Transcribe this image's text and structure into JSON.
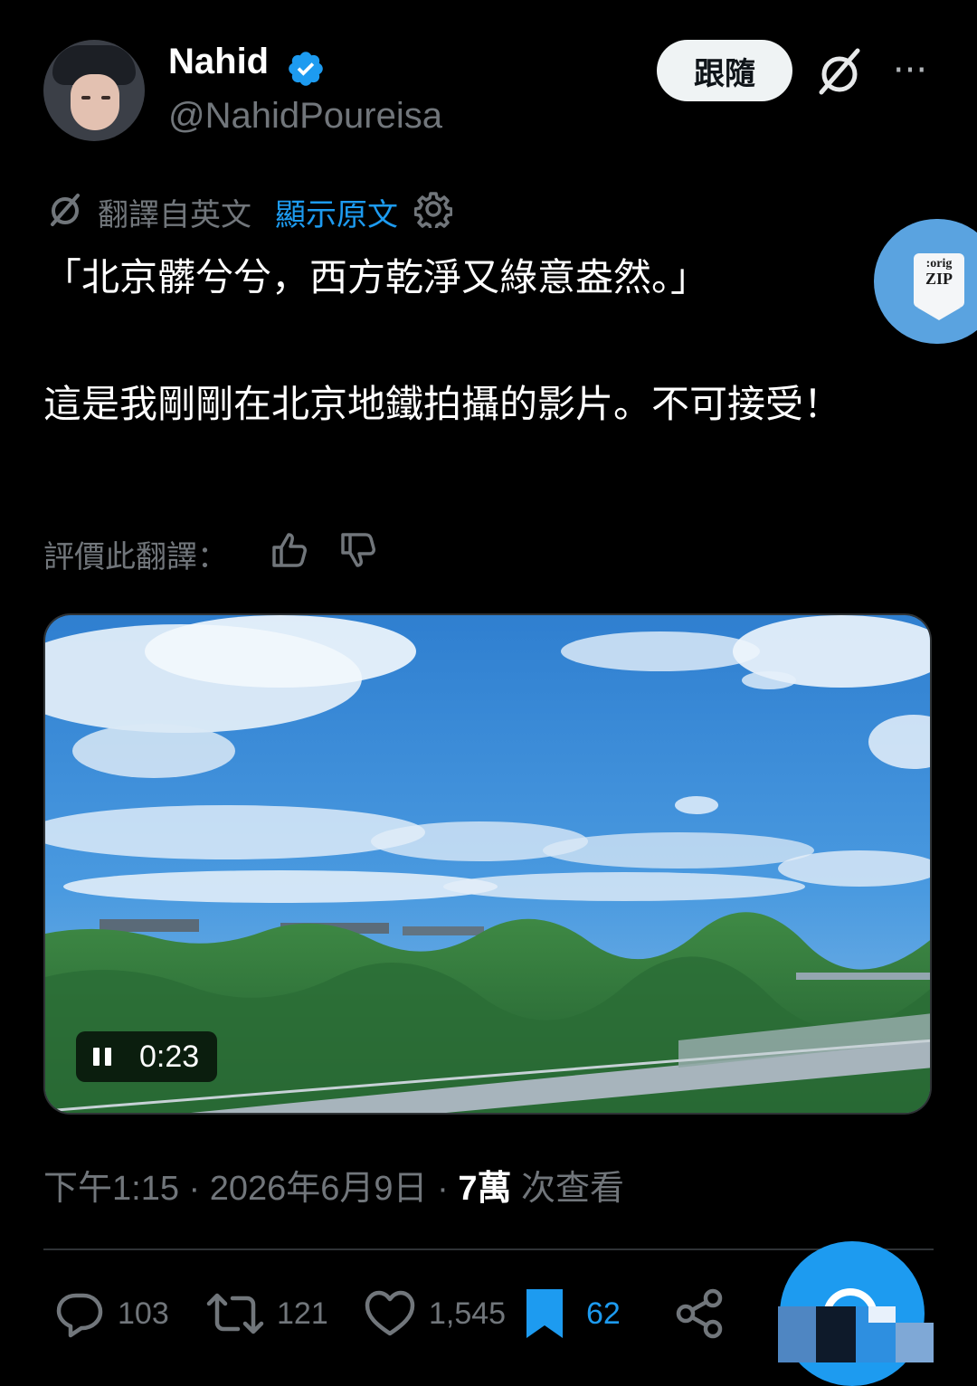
{
  "author": {
    "display_name": "Nahid",
    "handle": "@NahidPoureisa",
    "verified": true
  },
  "header": {
    "follow_label": "跟隨",
    "more_label": "···"
  },
  "translation": {
    "label": "翻譯自英文",
    "show_original": "顯示原文",
    "rate_label": "評價此翻譯："
  },
  "tweet": {
    "text": "「北京髒兮兮，西方乾淨又綠意盎然。」\n\n這是我剛剛在北京地鐵拍攝的影片。不可接受！"
  },
  "zip_badge": {
    "line1": ":orig",
    "line2": "ZIP"
  },
  "video": {
    "time": "0:23",
    "state": "playing"
  },
  "meta": {
    "time": "下午1:15",
    "sep1": " · ",
    "date": "2026年6月9日",
    "sep2": " · ",
    "views_count": "7萬",
    "views_label": " 次查看"
  },
  "actions": {
    "replies": "103",
    "reposts": "121",
    "likes": "1,545",
    "bookmarks": "62"
  },
  "colors": {
    "accent": "#1d9bf0",
    "background": "#000000",
    "muted_text": "#71767b"
  }
}
